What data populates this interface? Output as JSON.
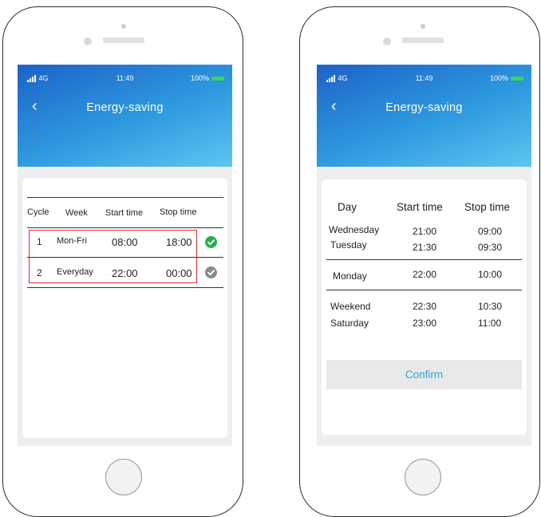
{
  "status": {
    "signal": "4G",
    "time": "11:49",
    "battery": "100%"
  },
  "header": {
    "title": "Energy-saving"
  },
  "left": {
    "columns": [
      "Cycle",
      "Week",
      "Start time",
      "Stop  time"
    ],
    "rows": [
      {
        "cycle": "1",
        "week": "Mon-Fri",
        "start": "08:00",
        "stop": "18:00",
        "status": "enabled"
      },
      {
        "cycle": "2",
        "week": "Everyday",
        "start": "22:00",
        "stop": "00:00",
        "status": "disabled"
      }
    ]
  },
  "right": {
    "columns": [
      "Day",
      "Start time",
      "Stop time"
    ],
    "groups": [
      [
        {
          "day": "Wednesday",
          "start": "21:00",
          "stop": "09:00"
        },
        {
          "day": "Tuesday",
          "start": "21:30",
          "stop": "09:30"
        }
      ],
      [
        {
          "day": "Monday",
          "start": "22:00",
          "stop": "10:00"
        }
      ],
      [
        {
          "day": "Weekend",
          "start": "22:30",
          "stop": "10:30"
        },
        {
          "day": "Saturday",
          "start": "23:00",
          "stop": "11:00"
        }
      ]
    ],
    "confirm_label": "Confirm"
  },
  "colors": {
    "enabled_check": "#22b04b",
    "disabled_check": "#8a8a8a",
    "highlight": "#e0303a",
    "accent": "#2aa7df"
  }
}
